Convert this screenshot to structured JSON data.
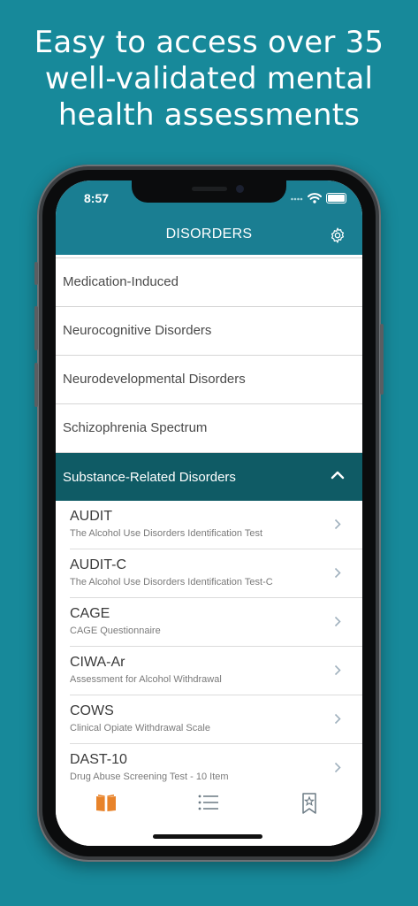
{
  "promo": {
    "line1": "Easy to access over 35",
    "line2": "well-validated mental",
    "line3": "health assessments"
  },
  "status": {
    "time": "8:57"
  },
  "nav": {
    "title": "DISORDERS",
    "settings_icon": "gear-icon"
  },
  "categories": [
    {
      "label": "Medication-Induced"
    },
    {
      "label": "Neurocognitive Disorders"
    },
    {
      "label": "Neurodevelopmental Disorders"
    },
    {
      "label": "Schizophrenia Spectrum"
    }
  ],
  "expanded": {
    "label": "Substance-Related Disorders",
    "items": [
      {
        "title": "AUDIT",
        "subtitle": "The Alcohol Use Disorders Identification Test"
      },
      {
        "title": "AUDIT-C",
        "subtitle": "The Alcohol Use Disorders Identification Test-C"
      },
      {
        "title": "CAGE",
        "subtitle": "CAGE Questionnaire"
      },
      {
        "title": "CIWA-Ar",
        "subtitle": "Assessment for Alcohol Withdrawal"
      },
      {
        "title": "COWS",
        "subtitle": "Clinical Opiate Withdrawal Scale"
      },
      {
        "title": "DAST-10",
        "subtitle": "Drug Abuse Screening Test - 10 Item"
      }
    ]
  },
  "tabs": [
    {
      "icon": "book-icon",
      "active": true
    },
    {
      "icon": "list-icon",
      "active": false
    },
    {
      "icon": "bookmark-star-icon",
      "active": false
    }
  ],
  "colors": {
    "background": "#17899a",
    "navbar": "#1a7e92",
    "expanded": "#0f5b65",
    "active_tab": "#e8832a"
  }
}
